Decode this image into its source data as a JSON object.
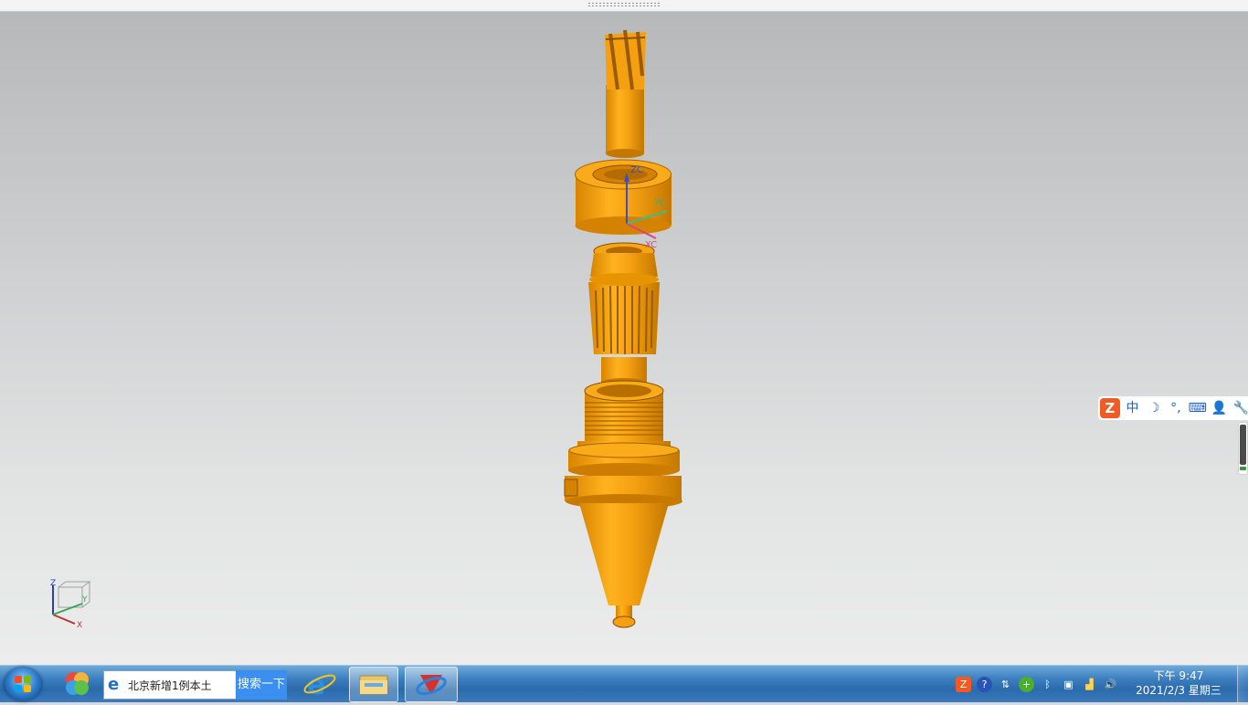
{
  "viewport": {
    "axis_labels": {
      "zc": "ZC",
      "yc": "YC",
      "xc": "XC"
    },
    "triad_labels": {
      "z": "Z",
      "y": "Y",
      "x": "X"
    }
  },
  "ime_bar": {
    "logo": "Z",
    "mode": "中",
    "half_full": "☽",
    "punct": "°,",
    "keyboard": "⌨",
    "user": "👤",
    "settings": "🔧"
  },
  "taskbar": {
    "search_text": "北京新增1例本土",
    "search_button": "搜索一下",
    "apps": [
      {
        "name": "ie",
        "icon": "ie-icon"
      },
      {
        "name": "explorer",
        "icon": "folder-icon"
      },
      {
        "name": "nx",
        "icon": "nx-app-icon"
      }
    ],
    "clock_time": "下午 9:47",
    "clock_date": "2021/2/3 星期三"
  },
  "colors": {
    "part": "#f5a011",
    "part_dark": "#b86f00",
    "taskbar": "#2b6aab"
  }
}
